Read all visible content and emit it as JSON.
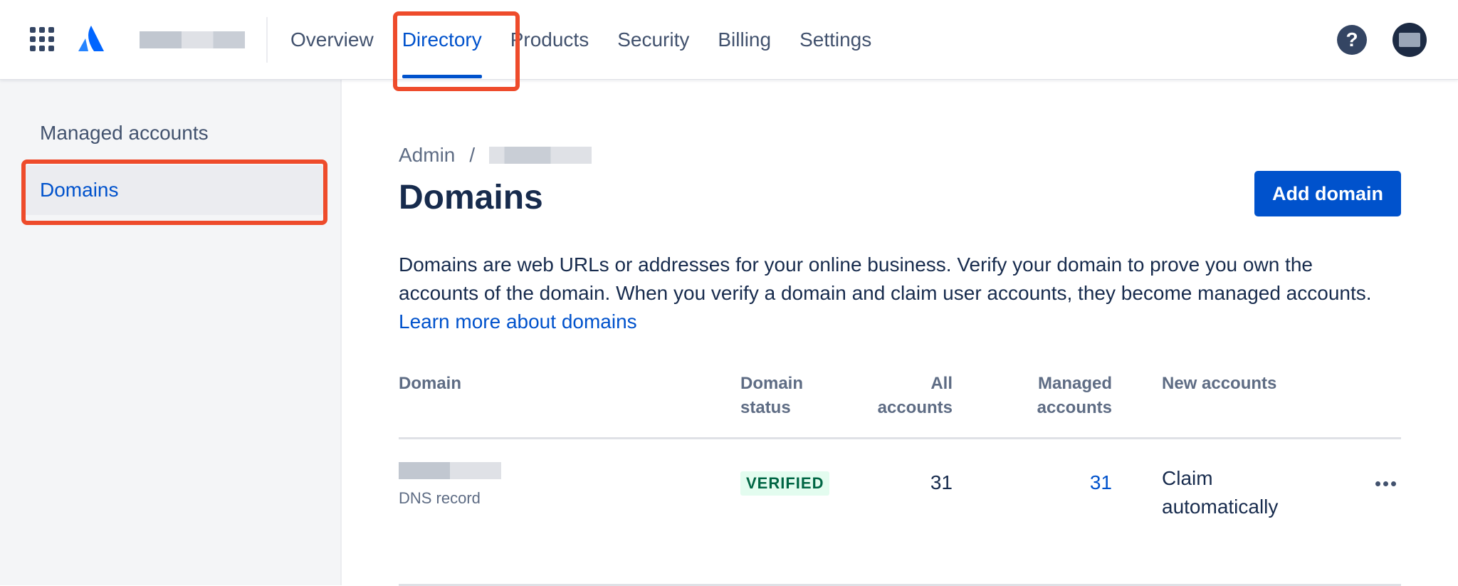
{
  "topnav": {
    "tabs": [
      {
        "label": "Overview"
      },
      {
        "label": "Directory"
      },
      {
        "label": "Products"
      },
      {
        "label": "Security"
      },
      {
        "label": "Billing"
      },
      {
        "label": "Settings"
      }
    ],
    "active_tab": "Directory",
    "help_glyph": "?",
    "icons": [
      "app-switcher-icon",
      "atlassian-logo-icon",
      "help-icon",
      "avatar"
    ],
    "accent_color": "#0052CC"
  },
  "sidebar": {
    "items": [
      {
        "label": "Managed accounts"
      },
      {
        "label": "Domains"
      }
    ],
    "active_item": "Domains"
  },
  "main": {
    "breadcrumb": {
      "root": "Admin",
      "separator": "/"
    },
    "title": "Domains",
    "add_button_label": "Add domain",
    "description": "Domains are web URLs or addresses for your online business. Verify your domain to prove you own the accounts of the domain. When you verify a domain and claim user accounts, they become managed accounts.",
    "learn_more_link": "Learn more about domains",
    "table": {
      "columns": [
        "Domain",
        "Domain status",
        "All accounts",
        "Managed accounts",
        "New accounts"
      ],
      "rows": [
        {
          "domain_method": "DNS record",
          "status": "VERIFIED",
          "all_accounts": "31",
          "managed_accounts": "31",
          "new_accounts": "Claim automatically"
        }
      ]
    }
  },
  "colors": {
    "highlight": "#EE4B2B",
    "verified_bg": "#E3FCEF",
    "verified_text": "#006644"
  }
}
